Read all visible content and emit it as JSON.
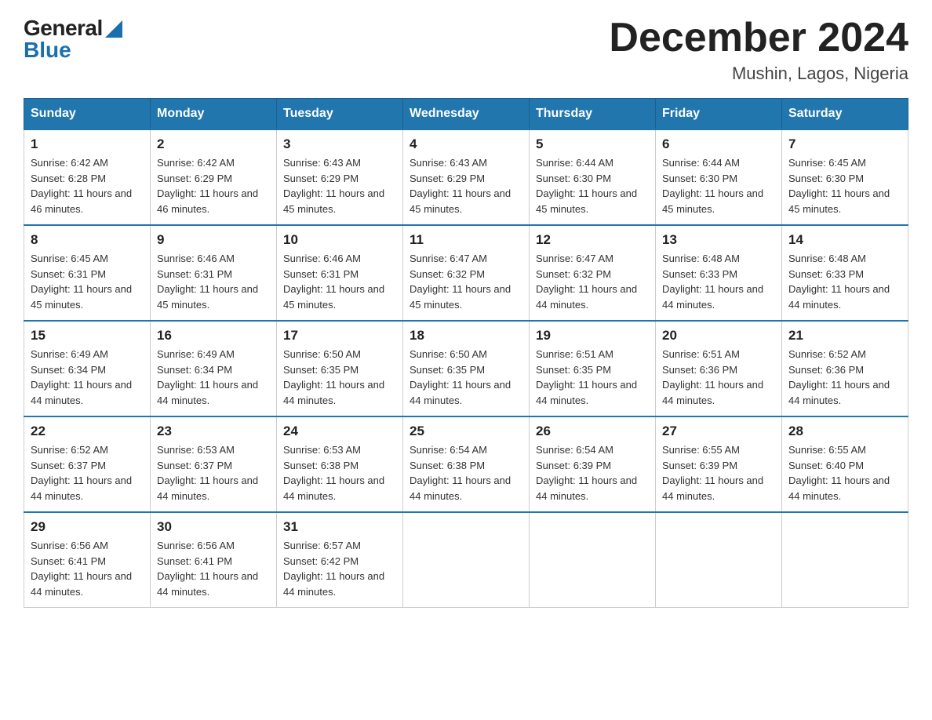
{
  "logo": {
    "general": "General",
    "blue": "Blue",
    "triangle_color": "#1a6faf"
  },
  "title": "December 2024",
  "subtitle": "Mushin, Lagos, Nigeria",
  "header_color": "#2176ae",
  "days": [
    "Sunday",
    "Monday",
    "Tuesday",
    "Wednesday",
    "Thursday",
    "Friday",
    "Saturday"
  ],
  "weeks": [
    [
      {
        "day": 1,
        "sunrise": "6:42 AM",
        "sunset": "6:28 PM",
        "daylight": "11 hours and 46 minutes."
      },
      {
        "day": 2,
        "sunrise": "6:42 AM",
        "sunset": "6:29 PM",
        "daylight": "11 hours and 46 minutes."
      },
      {
        "day": 3,
        "sunrise": "6:43 AM",
        "sunset": "6:29 PM",
        "daylight": "11 hours and 45 minutes."
      },
      {
        "day": 4,
        "sunrise": "6:43 AM",
        "sunset": "6:29 PM",
        "daylight": "11 hours and 45 minutes."
      },
      {
        "day": 5,
        "sunrise": "6:44 AM",
        "sunset": "6:30 PM",
        "daylight": "11 hours and 45 minutes."
      },
      {
        "day": 6,
        "sunrise": "6:44 AM",
        "sunset": "6:30 PM",
        "daylight": "11 hours and 45 minutes."
      },
      {
        "day": 7,
        "sunrise": "6:45 AM",
        "sunset": "6:30 PM",
        "daylight": "11 hours and 45 minutes."
      }
    ],
    [
      {
        "day": 8,
        "sunrise": "6:45 AM",
        "sunset": "6:31 PM",
        "daylight": "11 hours and 45 minutes."
      },
      {
        "day": 9,
        "sunrise": "6:46 AM",
        "sunset": "6:31 PM",
        "daylight": "11 hours and 45 minutes."
      },
      {
        "day": 10,
        "sunrise": "6:46 AM",
        "sunset": "6:31 PM",
        "daylight": "11 hours and 45 minutes."
      },
      {
        "day": 11,
        "sunrise": "6:47 AM",
        "sunset": "6:32 PM",
        "daylight": "11 hours and 45 minutes."
      },
      {
        "day": 12,
        "sunrise": "6:47 AM",
        "sunset": "6:32 PM",
        "daylight": "11 hours and 44 minutes."
      },
      {
        "day": 13,
        "sunrise": "6:48 AM",
        "sunset": "6:33 PM",
        "daylight": "11 hours and 44 minutes."
      },
      {
        "day": 14,
        "sunrise": "6:48 AM",
        "sunset": "6:33 PM",
        "daylight": "11 hours and 44 minutes."
      }
    ],
    [
      {
        "day": 15,
        "sunrise": "6:49 AM",
        "sunset": "6:34 PM",
        "daylight": "11 hours and 44 minutes."
      },
      {
        "day": 16,
        "sunrise": "6:49 AM",
        "sunset": "6:34 PM",
        "daylight": "11 hours and 44 minutes."
      },
      {
        "day": 17,
        "sunrise": "6:50 AM",
        "sunset": "6:35 PM",
        "daylight": "11 hours and 44 minutes."
      },
      {
        "day": 18,
        "sunrise": "6:50 AM",
        "sunset": "6:35 PM",
        "daylight": "11 hours and 44 minutes."
      },
      {
        "day": 19,
        "sunrise": "6:51 AM",
        "sunset": "6:35 PM",
        "daylight": "11 hours and 44 minutes."
      },
      {
        "day": 20,
        "sunrise": "6:51 AM",
        "sunset": "6:36 PM",
        "daylight": "11 hours and 44 minutes."
      },
      {
        "day": 21,
        "sunrise": "6:52 AM",
        "sunset": "6:36 PM",
        "daylight": "11 hours and 44 minutes."
      }
    ],
    [
      {
        "day": 22,
        "sunrise": "6:52 AM",
        "sunset": "6:37 PM",
        "daylight": "11 hours and 44 minutes."
      },
      {
        "day": 23,
        "sunrise": "6:53 AM",
        "sunset": "6:37 PM",
        "daylight": "11 hours and 44 minutes."
      },
      {
        "day": 24,
        "sunrise": "6:53 AM",
        "sunset": "6:38 PM",
        "daylight": "11 hours and 44 minutes."
      },
      {
        "day": 25,
        "sunrise": "6:54 AM",
        "sunset": "6:38 PM",
        "daylight": "11 hours and 44 minutes."
      },
      {
        "day": 26,
        "sunrise": "6:54 AM",
        "sunset": "6:39 PM",
        "daylight": "11 hours and 44 minutes."
      },
      {
        "day": 27,
        "sunrise": "6:55 AM",
        "sunset": "6:39 PM",
        "daylight": "11 hours and 44 minutes."
      },
      {
        "day": 28,
        "sunrise": "6:55 AM",
        "sunset": "6:40 PM",
        "daylight": "11 hours and 44 minutes."
      }
    ],
    [
      {
        "day": 29,
        "sunrise": "6:56 AM",
        "sunset": "6:41 PM",
        "daylight": "11 hours and 44 minutes."
      },
      {
        "day": 30,
        "sunrise": "6:56 AM",
        "sunset": "6:41 PM",
        "daylight": "11 hours and 44 minutes."
      },
      {
        "day": 31,
        "sunrise": "6:57 AM",
        "sunset": "6:42 PM",
        "daylight": "11 hours and 44 minutes."
      },
      null,
      null,
      null,
      null
    ]
  ]
}
